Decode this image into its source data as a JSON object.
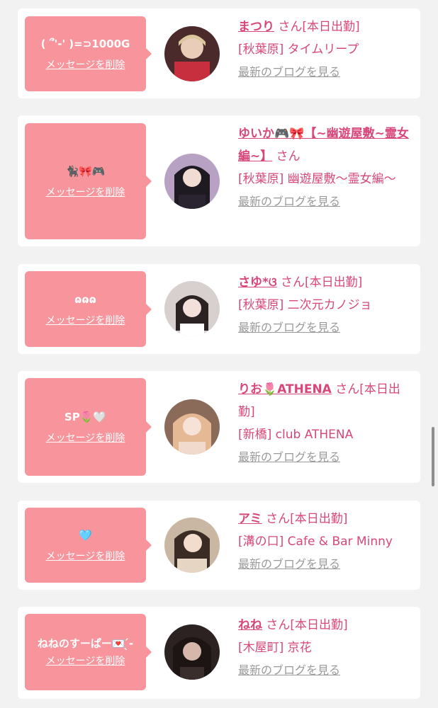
{
  "colors": {
    "accent": "#d8477a",
    "bubble": "#f7949c",
    "link_gray": "#9a9a9a",
    "background": "#f2f2f2"
  },
  "delete_label": "メッセージを削除",
  "blog_label": "最新のブログを見る",
  "entries": [
    {
      "message": "( ՞'-' )=⊃1000G",
      "name": "まつり",
      "suffix": "さん[本日出勤]",
      "shop": "[秋葉原] タイムリープ"
    },
    {
      "message": "🐈‍⬛🎀🎮",
      "name": "ゆいか🎮🎀【~幽遊屋敷~霊女編~】",
      "suffix": "さん",
      "shop": "[秋葉原] 幽遊屋敷～霊女編～"
    },
    {
      "message": "ɷɷɷ",
      "name": "さゆ*ଓ",
      "suffix": "さん[本日出勤]",
      "shop": "[秋葉原] 二次元カノジョ"
    },
    {
      "message": "SP🌷🤍",
      "name": "りお🌷ATHENA",
      "suffix": "さん[本日出勤]",
      "shop": "[新橋] club ATHENA"
    },
    {
      "message": "🩵",
      "name": "アミ",
      "suffix": "さん[本日出勤]",
      "shop": "[溝の口] Cafe & Bar Minny"
    },
    {
      "message": "ねねのすーぱー💌 ̖́-",
      "name": "ねね",
      "suffix": "さん[本日出勤]",
      "shop": "[木屋町] 京花"
    }
  ]
}
